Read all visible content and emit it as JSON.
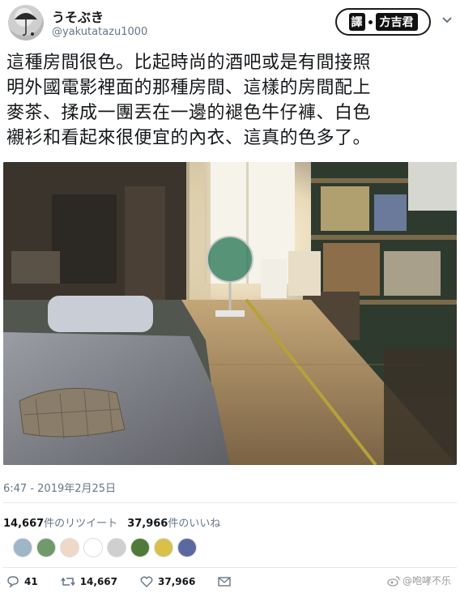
{
  "author": {
    "display_name": "うそぶき",
    "handle": "@yakutatazu1000"
  },
  "translator_badge": {
    "box_char": "譯",
    "name": "方吉君"
  },
  "tweet": {
    "lines": [
      "這種房間很色。比起時尚的酒吧或是有間接照",
      "明外國電影裡面的那種房間、這樣的房間配上",
      "麥茶、揉成一團丟在一邊的褪色牛仔褲、白色",
      "襯衫和看起來很便宜的內衣、這真的色多了。"
    ]
  },
  "timestamp": "6:47 - 2019年2月25日",
  "stats": {
    "retweets": "14,667",
    "retweets_label": "件のリツイート",
    "likes": "37,966",
    "likes_label": "件のいいね"
  },
  "liker_avatars": [
    {
      "color": "#9fb5c8"
    },
    {
      "color": "#6f9a6a"
    },
    {
      "color": "#f0d8c8"
    },
    {
      "color": "#ffffff"
    },
    {
      "color": "#cfcfcf"
    },
    {
      "color": "#4f7a3a"
    },
    {
      "color": "#d8c04a"
    },
    {
      "color": "#5a6aa0"
    }
  ],
  "actions": {
    "reply_count": "41",
    "retweet_count": "14,667",
    "like_count": "37,966"
  },
  "watermark": "@咆哮不乐"
}
